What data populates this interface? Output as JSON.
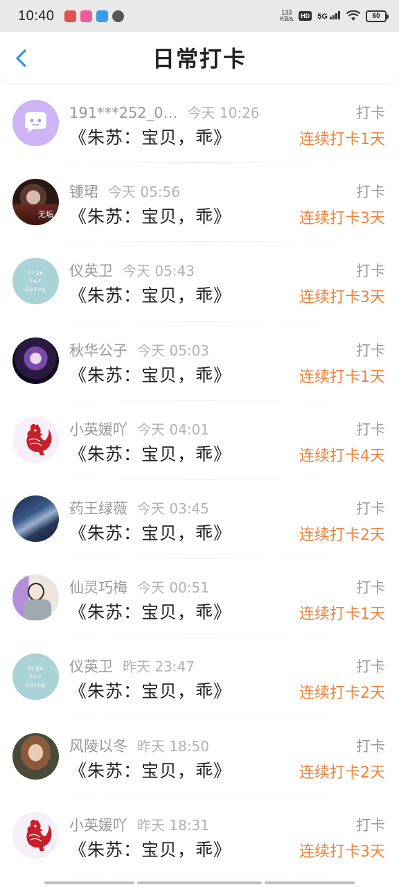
{
  "status_bar": {
    "time": "10:40",
    "net_speed_top": "133",
    "net_speed_unit": "KB/s",
    "hd": "HD",
    "signal": "5G",
    "battery": "60"
  },
  "header": {
    "title": "日常打卡"
  },
  "entries": [
    {
      "name": "191***252_0…",
      "time": "今天 10:26",
      "book": "《朱苏：宝贝，乖》",
      "action": "打卡",
      "streak": "连续打卡1天",
      "avatar": "avatar-chat-bubble"
    },
    {
      "name": "锺珺",
      "time": "今天 05:56",
      "book": "《朱苏：宝贝，乖》",
      "action": "打卡",
      "streak": "连续打卡3天",
      "avatar": "avatar-photo-man"
    },
    {
      "name": "仪英卫",
      "time": "今天 05:43",
      "book": "《朱苏：宝贝，乖》",
      "action": "打卡",
      "streak": "连续打卡3天",
      "avatar": "avatar-urge-for-going"
    },
    {
      "name": "秋华公子",
      "time": "今天 05:03",
      "book": "《朱苏：宝贝，乖》",
      "action": "打卡",
      "streak": "连续打卡1天",
      "avatar": "avatar-anime-girl"
    },
    {
      "name": "小英媛吖",
      "time": "今天 04:01",
      "book": "《朱苏：宝贝，乖》",
      "action": "打卡",
      "streak": "连续打卡4天",
      "avatar": "avatar-red-rooster"
    },
    {
      "name": "药王绿薇",
      "time": "今天 03:45",
      "book": "《朱苏：宝贝，乖》",
      "action": "打卡",
      "streak": "连续打卡2天",
      "avatar": "avatar-night-sky"
    },
    {
      "name": "仙灵巧梅",
      "time": "今天 00:51",
      "book": "《朱苏：宝贝，乖》",
      "action": "打卡",
      "streak": "连续打卡1天",
      "avatar": "avatar-illustration-girl"
    },
    {
      "name": "仪英卫",
      "time": "昨天 23:47",
      "book": "《朱苏：宝贝，乖》",
      "action": "打卡",
      "streak": "连续打卡2天",
      "avatar": "avatar-urge-for-going"
    },
    {
      "name": "风陵以冬",
      "time": "昨天 18:50",
      "book": "《朱苏：宝贝，乖》",
      "action": "打卡",
      "streak": "连续打卡2天",
      "avatar": "avatar-photo-woman"
    },
    {
      "name": "小英媛吖",
      "time": "昨天 18:31",
      "book": "《朱苏：宝贝，乖》",
      "action": "打卡",
      "streak": "连续打卡3天",
      "avatar": "avatar-red-rooster"
    }
  ],
  "urge_avatar_text": [
    "Urge",
    "For",
    "Going"
  ],
  "avatar_overlay_text": "无垢",
  "colors": {
    "accent": "#f0833a",
    "back_arrow": "#3a8ee6",
    "muted": "#999999"
  }
}
